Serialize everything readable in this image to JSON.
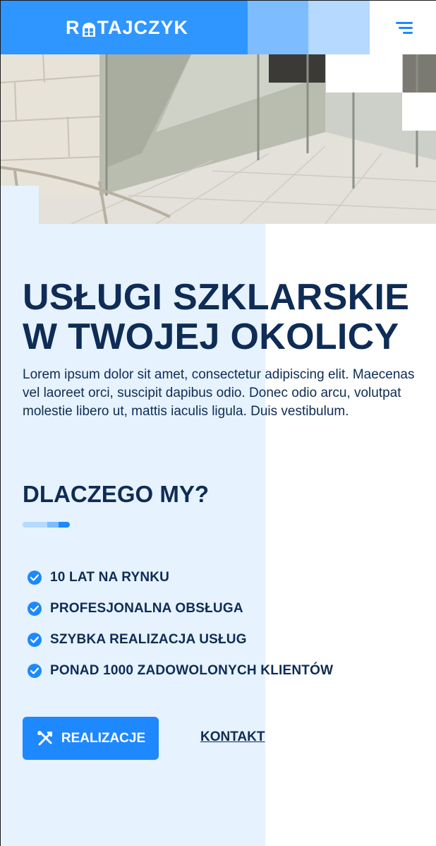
{
  "header": {
    "logo_text_before": "R",
    "logo_text_after": "TAJCZYK",
    "logo_icon": "window-icon",
    "menu_icon": "hamburger-menu-icon"
  },
  "hero": {
    "image": "glass-building-facade-photo"
  },
  "main": {
    "headline_line1": "USŁUGI SZKLARSKIE",
    "headline_line2": "W TWOJEJ OKOLICY",
    "lead": "Lorem ipsum dolor sit amet, consectetur adipiscing elit. Maecenas vel laoreet orci, suscipit dapibus odio. Donec odio arcu, volutpat molestie libero ut, mattis iaculis ligula. Duis vestibulum."
  },
  "why": {
    "title": "DLACZEGO MY?",
    "items": [
      {
        "label": "10 LAT NA RYNKU",
        "icon": "check-circle-icon"
      },
      {
        "label": "PROFESJONALNA OBSŁUGA",
        "icon": "check-circle-icon"
      },
      {
        "label": "SZYBKA REALIZACJA USŁUG",
        "icon": "check-circle-icon"
      },
      {
        "label": "PONAD 1000 ZADOWOLONYCH KLIENTÓW",
        "icon": "check-circle-icon"
      }
    ]
  },
  "actions": {
    "primary_label": "REALIZACJE",
    "primary_icon": "tools-icon",
    "secondary_label": "KONTAKT"
  },
  "colors": {
    "brand_blue": "#1e88ff",
    "header_blue": "#2f95ff",
    "navy_text": "#0e2c55",
    "panel_bg": "#e6f2fe"
  }
}
